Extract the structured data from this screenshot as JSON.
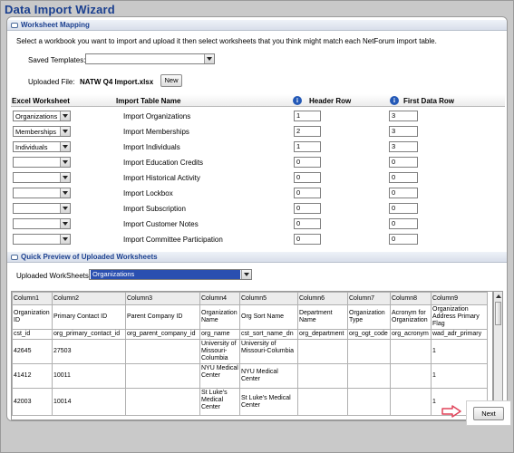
{
  "window": {
    "title": "Data Import Wizard"
  },
  "mapping": {
    "header": "Worksheet Mapping",
    "instruction": "Select a workbook you want to import and upload it then select worksheets that you think might match each NetForum import table.",
    "saved_templates_label": "Saved Templates:",
    "saved_templates_value": "",
    "uploaded_file_label": "Uploaded File:",
    "uploaded_file_name": "NATW Q4 Import.xlsx",
    "new_button": "New",
    "columns": {
      "excel_worksheet": "Excel Worksheet",
      "import_table": "Import Table Name",
      "header_row": "Header Row",
      "first_data_row": "First Data Row"
    },
    "info_icon_glyph": "i",
    "rows": [
      {
        "worksheet": "Organizations",
        "table": "Import Organizations",
        "header_row": "1",
        "first_data_row": "3"
      },
      {
        "worksheet": "Memberships",
        "table": "Import Memberships",
        "header_row": "2",
        "first_data_row": "3"
      },
      {
        "worksheet": "Individuals",
        "table": "Import Individuals",
        "header_row": "1",
        "first_data_row": "3"
      },
      {
        "worksheet": "",
        "table": "Import Education Credits",
        "header_row": "0",
        "first_data_row": "0"
      },
      {
        "worksheet": "",
        "table": "Import Historical Activity",
        "header_row": "0",
        "first_data_row": "0"
      },
      {
        "worksheet": "",
        "table": "Import Lockbox",
        "header_row": "0",
        "first_data_row": "0"
      },
      {
        "worksheet": "",
        "table": "Import Subscription",
        "header_row": "0",
        "first_data_row": "0"
      },
      {
        "worksheet": "",
        "table": "Import Customer Notes",
        "header_row": "0",
        "first_data_row": "0"
      },
      {
        "worksheet": "",
        "table": "Import Committee Participation",
        "header_row": "0",
        "first_data_row": "0"
      }
    ]
  },
  "preview": {
    "header": "Quick Preview of Uploaded Worksheets",
    "uploaded_worksheets_label": "Uploaded WorkSheets:",
    "uploaded_worksheets_value": "Organizations",
    "columns": [
      "Column1",
      "Column2",
      "Column3",
      "Column4",
      "Column5",
      "Column6",
      "Column7",
      "Column8",
      "Column9"
    ],
    "rows": [
      [
        "Organization ID",
        "Primary Contact ID",
        "Parent Company ID",
        "Organization Name",
        "Org Sort Name",
        "Department Name",
        "Organization Type",
        "Acronym for Organization",
        "Organization Address Primary Flag"
      ],
      [
        "cst_id",
        "org_primary_contact_id",
        "org_parent_company_id",
        "org_name",
        "cst_sort_name_dn",
        "org_department",
        "org_ogt_code",
        "org_acronym",
        "wad_adr_primary"
      ],
      [
        "42645",
        "27503",
        "",
        "University of Missouri-Columbia",
        "University of Missouri-Columbia",
        "",
        "",
        "",
        "1"
      ],
      [
        "41412",
        "10011",
        "",
        "NYU Medical Center",
        "NYU Medical Center",
        "",
        "",
        "",
        "1"
      ],
      [
        "42003",
        "10014",
        "",
        "St Luke's Medical Center",
        "St Luke's Medical Center",
        "",
        "",
        "",
        "1"
      ]
    ]
  },
  "footer": {
    "next_button": "Next"
  },
  "colors": {
    "title": "#1a3f8f",
    "info_icon": "#2459b7",
    "selected_highlight": "#2a4fb0",
    "callout_arrow": "#e0445a"
  }
}
